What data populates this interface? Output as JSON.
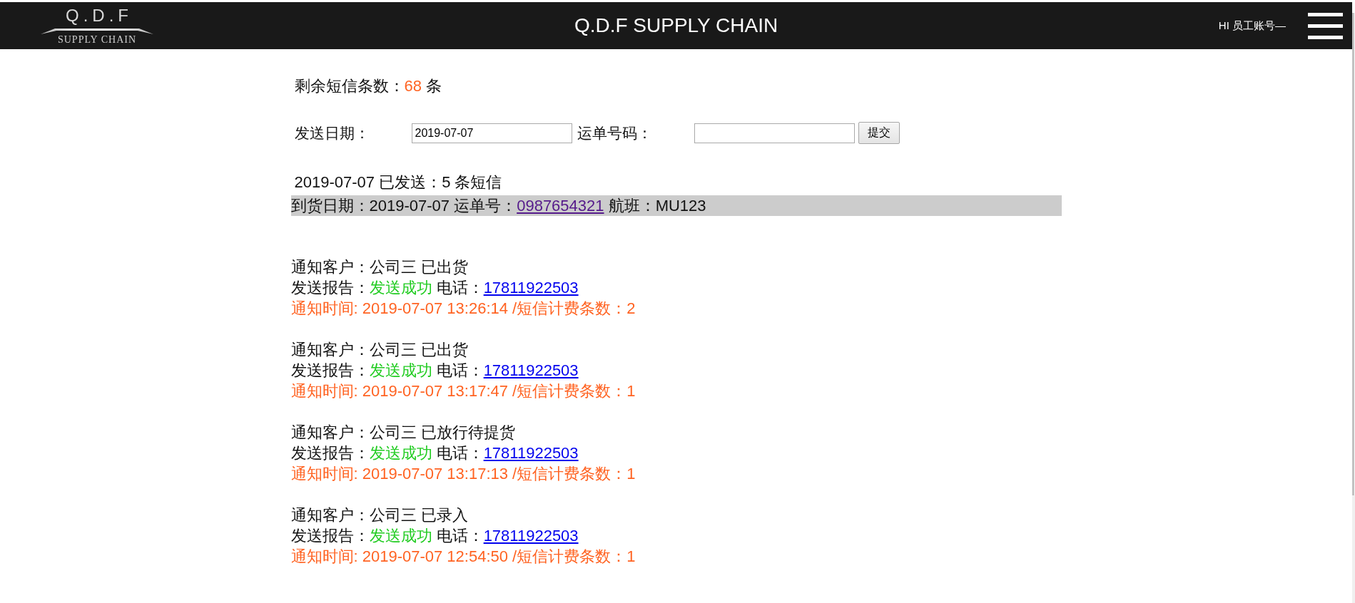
{
  "header": {
    "logo": {
      "mark": "Q.D.F",
      "tagline": "SUPPLY CHAIN"
    },
    "title": "Q.D.F SUPPLY CHAIN",
    "greeting": "HI 员工账号—"
  },
  "sms_balance": {
    "label": "剩余短信条数：",
    "count": "68",
    "unit": "条"
  },
  "search_form": {
    "fields": [
      {
        "label": "发送日期：",
        "value": "2019-07-07"
      },
      {
        "label": "运单号码："
      }
    ],
    "submit": "提交"
  },
  "summary": "2019-07-07 已发送：5 条短信",
  "shipment": {
    "arrival": "到货日期：2019-07-07",
    "waybill_label": "运单号：",
    "waybill": "0987654321",
    "flight": "航班：MU123"
  },
  "notifications": [
    {
      "customer": "通知客户：公司三 已出货",
      "report_label": "发送报告：",
      "status": "发送成功",
      "phone_label": "电话：",
      "phone": "17811922503",
      "time": "通知时间: 2019-07-07 13:26:14 /短信计费条数：2"
    },
    {
      "customer": "通知客户：公司三 已出货",
      "report_label": "发送报告：",
      "status": "发送成功",
      "phone_label": "电话：",
      "phone": "17811922503",
      "time": "通知时间: 2019-07-07 13:17:47 /短信计费条数：1"
    },
    {
      "customer": "通知客户：公司三 已放行待提货",
      "report_label": "发送报告：",
      "status": "发送成功",
      "phone_label": "电话：",
      "phone": "17811922503",
      "time": "通知时间: 2019-07-07 13:17:13 /短信计费条数：1"
    },
    {
      "customer": "通知客户：公司三 已录入",
      "report_label": "发送报告：",
      "status": "发送成功",
      "phone_label": "电话：",
      "phone": "17811922503",
      "time": "通知时间: 2019-07-07 12:54:50 /短信计费条数：1"
    }
  ]
}
